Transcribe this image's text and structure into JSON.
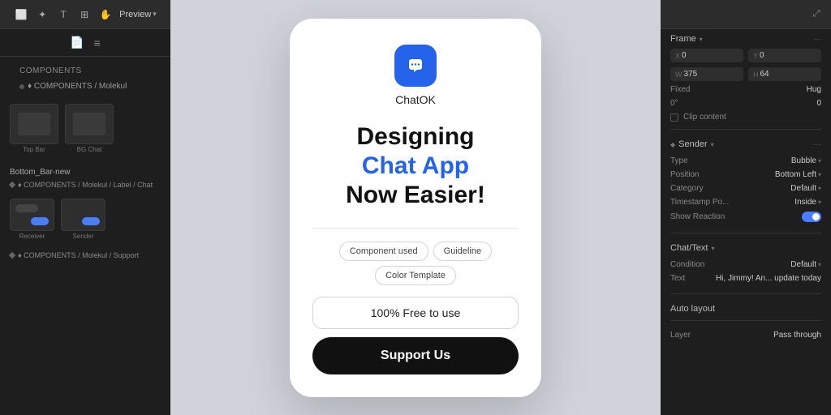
{
  "app": {
    "name": "ChatOK",
    "tagline_line1": "Designing",
    "tagline_line2": "Chat App",
    "tagline_line3": "Now Easier!",
    "free_label": "100% Free to use",
    "support_label": "Support Us"
  },
  "tags": [
    {
      "label": "Component used"
    },
    {
      "label": "Guideline"
    },
    {
      "label": "Color Template"
    }
  ],
  "left_panel": {
    "preview_label": "Preview",
    "section_title": "COMPONENTS",
    "section_sub": "♦ COMPONENTS / Molekul",
    "top_bar_label": "Top Bar",
    "bottom_bar_label": "Bottom_Bar-new",
    "bottom_bar_sub": "♦ COMPONENTS / Molekul / Label / Chat",
    "receiver_label": "Receiver",
    "sender_label": "Sender",
    "support_sub": "♦ COMPONENTS / Molekul / Support",
    "bg_chat_label": "BG Chat"
  },
  "right_panel": {
    "frame_title": "Frame",
    "x_label": "X",
    "x_value": "0",
    "y_label": "Y",
    "y_value": "0",
    "w_label": "W",
    "w_value": "375",
    "h_label": "H",
    "h_value": "64",
    "fixed_label": "Fixed",
    "hug_label": "Hug",
    "rotation_label": "0°",
    "clip_content_label": "Clip content",
    "sender_section": "Sender",
    "type_label": "Type",
    "type_value": "Bubble",
    "position_label": "Position",
    "position_value": "Bottom Left",
    "category_label": "Category",
    "category_value": "Default",
    "timestamp_label": "Timestamp Po...",
    "timestamp_value": "Inside",
    "show_reaction_label": "Show Reaction",
    "chat_section": "Chat/Text",
    "condition_label": "Condition",
    "condition_value": "Default",
    "text_label": "Text",
    "text_value": "Hi, Jimmy! An... update today",
    "auto_layout_title": "Auto layout",
    "layer_title": "Layer",
    "layer_value": "Pass through"
  }
}
